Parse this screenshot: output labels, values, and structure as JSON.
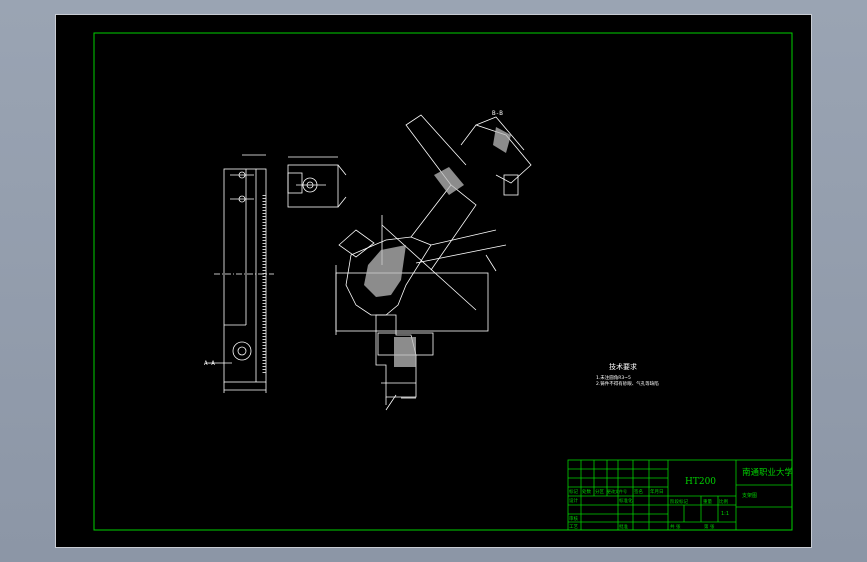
{
  "drawing": {
    "material": "HT200",
    "school": "南通职业大学",
    "drawing_name": "支架图",
    "scale": "1:1",
    "tech_title": "技术要求",
    "tech_notes": [
      "1.未注圆角R3~5",
      "2.铸件不得有砂眼、气孔等缺陷"
    ],
    "section_labels": [
      "A-A",
      "B-B"
    ],
    "title_block": {
      "row_labels": [
        "标记",
        "处数",
        "分区",
        "更改文件号",
        "签名",
        "年月日"
      ],
      "design": "设计",
      "standard": "标准化",
      "check": "审核",
      "process": "工艺",
      "approve": "批准",
      "stage_mark": "阶段标记",
      "weight": "重量",
      "ratio": "比例",
      "sheet_total": "共 张",
      "sheet_no": "第 张"
    }
  },
  "colors": {
    "frame": "#00d000",
    "lines": "#ffffff",
    "hatch": "#d0d0d0",
    "background": "#000000"
  }
}
